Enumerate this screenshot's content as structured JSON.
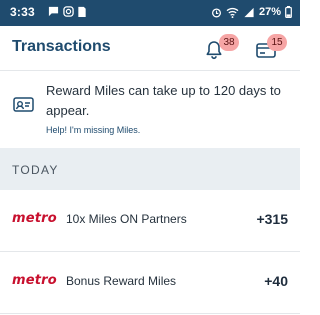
{
  "status_bar": {
    "time": "3:33",
    "battery": "27%"
  },
  "header": {
    "title": "Transactions",
    "notifications_count": "38",
    "wallet_count": "15"
  },
  "notice": {
    "text": "Reward Miles can take up to 120 days to appear.",
    "help_link": "Help! I'm missing Miles."
  },
  "section": {
    "label": "TODAY"
  },
  "transactions": [
    {
      "partner_logo": "metro",
      "description": "10x Miles ON Partners",
      "amount": "+315"
    },
    {
      "partner_logo": "metro",
      "description": "Bonus Reward Miles",
      "amount": "+40"
    }
  ],
  "colors": {
    "primary": "#1f4b6e",
    "badge": "#f6a5a5",
    "metro_red": "#c8102e",
    "section_bg": "#e9eef2"
  }
}
